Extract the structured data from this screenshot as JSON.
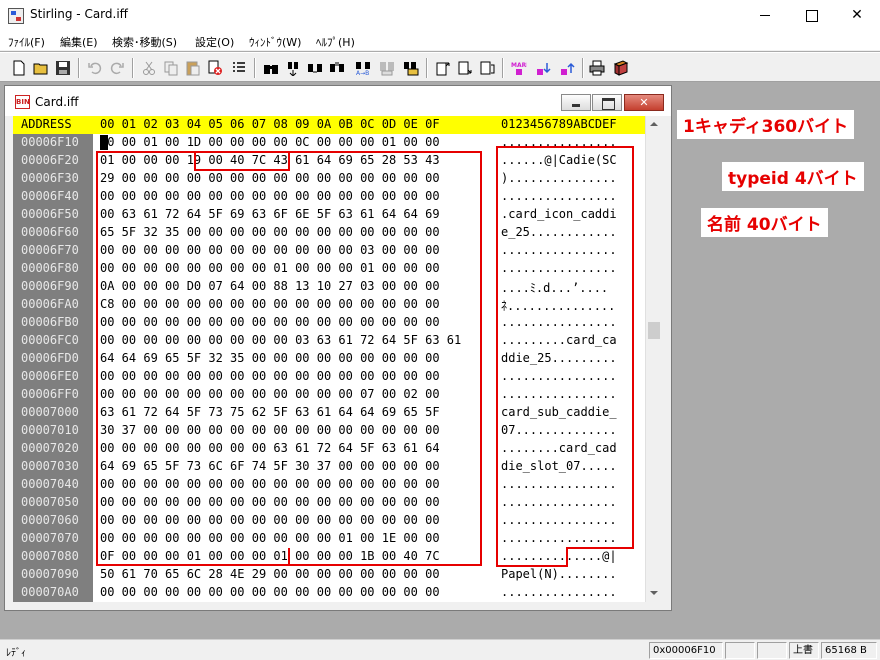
{
  "window": {
    "title": "Stirling - Card.iff"
  },
  "menu": [
    "ﾌｧｲﾙ(F)",
    "編集(E)",
    "検索･移動(S)",
    "設定(O)",
    "ｳｨﾝﾄﾞｳ(W)",
    "ﾍﾙﾌﾟ(H)"
  ],
  "toolbar_icons": [
    "new-file-icon",
    "open-folder-icon",
    "save-icon",
    "undo-icon",
    "redo-icon",
    "cut-icon",
    "copy-icon",
    "paste-icon",
    "delete-icon",
    "list-icon",
    "find-icon",
    "find-next-icon",
    "find-prev-icon",
    "find-all-icon",
    "replace-icon",
    "compare-icon",
    "jump-icon",
    "insert-before-icon",
    "insert-after-icon",
    "insert-end-icon",
    "mark-icon",
    "mark-next-icon",
    "mark-prev-icon",
    "print-icon",
    "book-icon"
  ],
  "child": {
    "title": "Card.iff"
  },
  "header": {
    "address": "ADDRESS",
    "bytes": "00 01 02 03 04 05 06 07 08 09 0A 0B 0C 0D 0E 0F",
    "ascii": "0123456789ABCDEF"
  },
  "rows": [
    {
      "addr": "00006F10",
      "bytes": "00 00 01 00 1D 00 00 00 00 0C 00 00 00 01 00 00",
      "ascii": "................"
    },
    {
      "addr": "00006F20",
      "bytes": "01 00 00 00 19 00 40 7C 43 61 64 69 65 28 53 43",
      "ascii": "......@|Cadie(SC"
    },
    {
      "addr": "00006F30",
      "bytes": "29 00 00 00 00 00 00 00 00 00 00 00 00 00 00 00",
      "ascii": ")..............."
    },
    {
      "addr": "00006F40",
      "bytes": "00 00 00 00 00 00 00 00 00 00 00 00 00 00 00 00",
      "ascii": "................"
    },
    {
      "addr": "00006F50",
      "bytes": "00 63 61 72 64 5F 69 63 6F 6E 5F 63 61 64 64 69",
      "ascii": ".card_icon_caddi"
    },
    {
      "addr": "00006F60",
      "bytes": "65 5F 32 35 00 00 00 00 00 00 00 00 00 00 00 00",
      "ascii": "e_25............"
    },
    {
      "addr": "00006F70",
      "bytes": "00 00 00 00 00 00 00 00 00 00 00 00 03 00 00 00",
      "ascii": "................"
    },
    {
      "addr": "00006F80",
      "bytes": "00 00 00 00 00 00 00 00 01 00 00 00 01 00 00 00",
      "ascii": "................"
    },
    {
      "addr": "00006F90",
      "bytes": "0A 00 00 00 D0 07 64 00 88 13 10 27 03 00 00 00",
      "ascii": "....ﾐ.d...’...."
    },
    {
      "addr": "00006FA0",
      "bytes": "C8 00 00 00 00 00 00 00 00 00 00 00 00 00 00 00",
      "ascii": "ﾈ..............."
    },
    {
      "addr": "00006FB0",
      "bytes": "00 00 00 00 00 00 00 00 00 00 00 00 00 00 00 00",
      "ascii": "................"
    },
    {
      "addr": "00006FC0",
      "bytes": "00 00 00 00 00 00 00 00 00 03 63 61 72 64 5F 63 61",
      "ascii": ".........card_ca"
    },
    {
      "addr": "00006FD0",
      "bytes": "64 64 69 65 5F 32 35 00 00 00 00 00 00 00 00 00",
      "ascii": "ddie_25........."
    },
    {
      "addr": "00006FE0",
      "bytes": "00 00 00 00 00 00 00 00 00 00 00 00 00 00 00 00",
      "ascii": "................"
    },
    {
      "addr": "00006FF0",
      "bytes": "00 00 00 00 00 00 00 00 00 00 00 00 07 00 02 00",
      "ascii": "................"
    },
    {
      "addr": "00007000",
      "bytes": "63 61 72 64 5F 73 75 62 5F 63 61 64 64 69 65 5F",
      "ascii": "card_sub_caddie_"
    },
    {
      "addr": "00007010",
      "bytes": "30 37 00 00 00 00 00 00 00 00 00 00 00 00 00 00",
      "ascii": "07.............."
    },
    {
      "addr": "00007020",
      "bytes": "00 00 00 00 00 00 00 00 63 61 72 64 5F 63 61 64",
      "ascii": "........card_cad"
    },
    {
      "addr": "00007030",
      "bytes": "64 69 65 5F 73 6C 6F 74 5F 30 37 00 00 00 00 00",
      "ascii": "die_slot_07....."
    },
    {
      "addr": "00007040",
      "bytes": "00 00 00 00 00 00 00 00 00 00 00 00 00 00 00 00",
      "ascii": "................"
    },
    {
      "addr": "00007050",
      "bytes": "00 00 00 00 00 00 00 00 00 00 00 00 00 00 00 00",
      "ascii": "................"
    },
    {
      "addr": "00007060",
      "bytes": "00 00 00 00 00 00 00 00 00 00 00 00 00 00 00 00",
      "ascii": "................"
    },
    {
      "addr": "00007070",
      "bytes": "00 00 00 00 00 00 00 00 00 00 00 01 00 1E 00 00",
      "ascii": "................"
    },
    {
      "addr": "00007080",
      "bytes": "0F 00 00 00 01 00 00 00 01 00 00 00 1B 00 40 7C",
      "ascii": "..............@|"
    },
    {
      "addr": "00007090",
      "bytes": "50 61 70 65 6C 28 4E 29 00 00 00 00 00 00 00 00",
      "ascii": "Papel(N)........"
    },
    {
      "addr": "000070A0",
      "bytes": "00 00 00 00 00 00 00 00 00 00 00 00 00 00 00 00",
      "ascii": "................"
    }
  ],
  "annotations": {
    "caddie_size": "1キャディ360バイト",
    "typeid": "typeid 4バイト",
    "name": "名前 40バイト"
  },
  "status": {
    "text": "ﾚﾃﾞｨ",
    "offset": "0x00006F10",
    "mode": "上書",
    "size": "65168 B"
  },
  "colors": {
    "header_bg": "#ffff00",
    "annotation_red": "#e60000",
    "address_bg": "#7f7f7f"
  }
}
